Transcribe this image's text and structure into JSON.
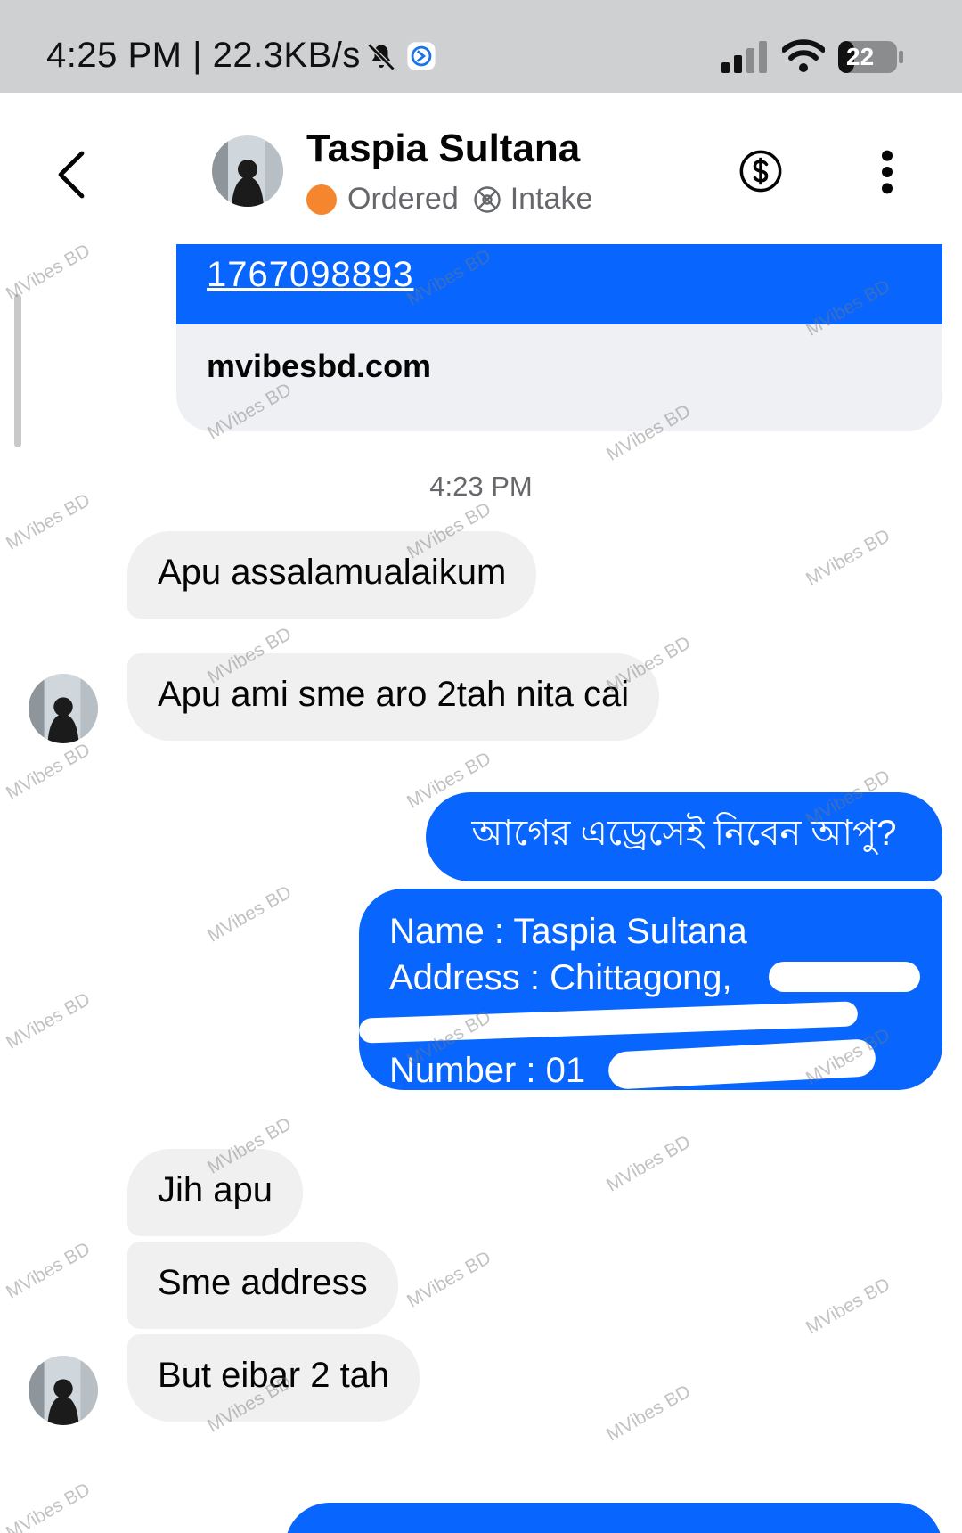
{
  "status_bar": {
    "time": "4:25 PM | 22.3KB/s",
    "battery": "22"
  },
  "header": {
    "name": "Taspia Sultana",
    "status_label": "Ordered",
    "status_color": "#f5862e",
    "tag_label": "Intake"
  },
  "link_preview": {
    "url": "1767098893",
    "domain": "mvibesbd.com"
  },
  "timestamp": "4:23 PM",
  "messages": [
    {
      "side": "in",
      "text": "Apu assalamualaikum"
    },
    {
      "side": "in",
      "text": "Apu ami sme aro 2tah nita cai"
    },
    {
      "side": "out",
      "text": "আগের এড্রেসেই নিবেন আপু?"
    },
    {
      "side": "out",
      "lines": [
        "Name : Taspia Sultana",
        "Address : Chittagong,",
        "Number : 01"
      ]
    },
    {
      "side": "in",
      "text": "Jih apu"
    },
    {
      "side": "in",
      "text": "Sme address"
    },
    {
      "side": "in",
      "text": "But eibar 2 tah"
    }
  ],
  "watermark_text": "MVibes BD",
  "colors": {
    "accent": "#0866ff",
    "incoming_bubble": "#f0f0f0",
    "status_bar_bg": "#cfd0d2"
  },
  "icons": {
    "back": "chevron-left-icon",
    "payment": "dollar-circle-icon",
    "more": "more-vertical-icon",
    "mute": "bell-off-icon",
    "intake": "intake-icon"
  }
}
